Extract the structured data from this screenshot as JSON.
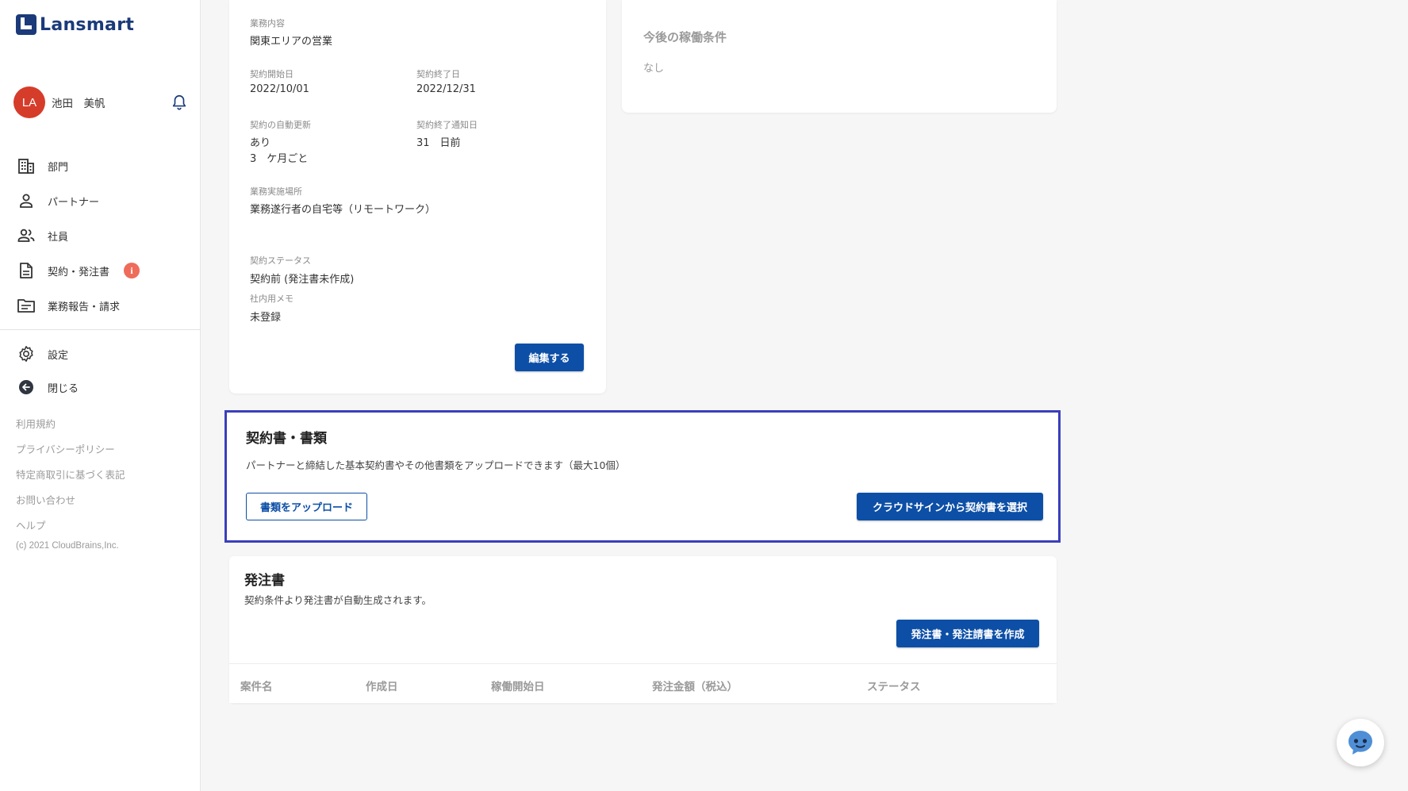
{
  "app": {
    "logo_text": "Lansmart"
  },
  "user": {
    "initials": "LA",
    "name": "池田　美帆"
  },
  "sidebar": {
    "items": [
      {
        "label": "部門",
        "icon": "building-icon"
      },
      {
        "label": "パートナー",
        "icon": "person-icon"
      },
      {
        "label": "社員",
        "icon": "people-icon"
      },
      {
        "label": "契約・発注書",
        "icon": "document-icon",
        "badge": "i"
      },
      {
        "label": "業務報告・請求",
        "icon": "folder-icon"
      }
    ],
    "secondary": [
      {
        "label": "設定",
        "icon": "gear-icon"
      },
      {
        "label": "閉じる",
        "icon": "back-arrow-icon"
      }
    ],
    "footer_links": [
      "利用規約",
      "プライバシーポリシー",
      "特定商取引に基づく表記",
      "お問い合わせ",
      "ヘルプ"
    ],
    "copyright": "(c) 2021 CloudBrains,Inc."
  },
  "contract_info": {
    "fields": {
      "business_content": {
        "label": "業務内容",
        "value": "関東エリアの営業"
      },
      "start_date": {
        "label": "契約開始日",
        "value": "2022/10/01"
      },
      "end_date": {
        "label": "契約終了日",
        "value": "2022/12/31"
      },
      "auto_renew": {
        "label": "契約の自動更新",
        "value": "あり",
        "value2": "3　ケ月ごと"
      },
      "end_notice": {
        "label": "契約終了通知日",
        "value": "31　日前"
      },
      "location": {
        "label": "業務実施場所",
        "value": "業務遂行者の自宅等（リモートワーク）"
      },
      "status": {
        "label": "契約ステータス",
        "value": "契約前 (発注書未作成)"
      },
      "memo": {
        "label": "社内用メモ",
        "value": "未登録"
      }
    },
    "edit_button": "編集する"
  },
  "future_conditions": {
    "title": "今後の稼働条件",
    "value": "なし"
  },
  "documents": {
    "title": "契約書・書類",
    "description": "パートナーと締結した基本契約書やその他書類をアップロードできます（最大10個）",
    "upload_button": "書類をアップロード",
    "cloudsign_button": "クラウドサインから契約書を選択"
  },
  "purchase_orders": {
    "title": "発注書",
    "description": "契約条件より発注書が自動生成されます。",
    "create_button": "発注書・発注請書を作成",
    "columns": [
      "案件名",
      "作成日",
      "稼働開始日",
      "発注金額（税込）",
      "ステータス"
    ]
  },
  "colors": {
    "primary": "#0d4fa6",
    "highlight": "#3b3fbb",
    "avatar": "#d63c2a",
    "badge": "#ef6b5a"
  }
}
